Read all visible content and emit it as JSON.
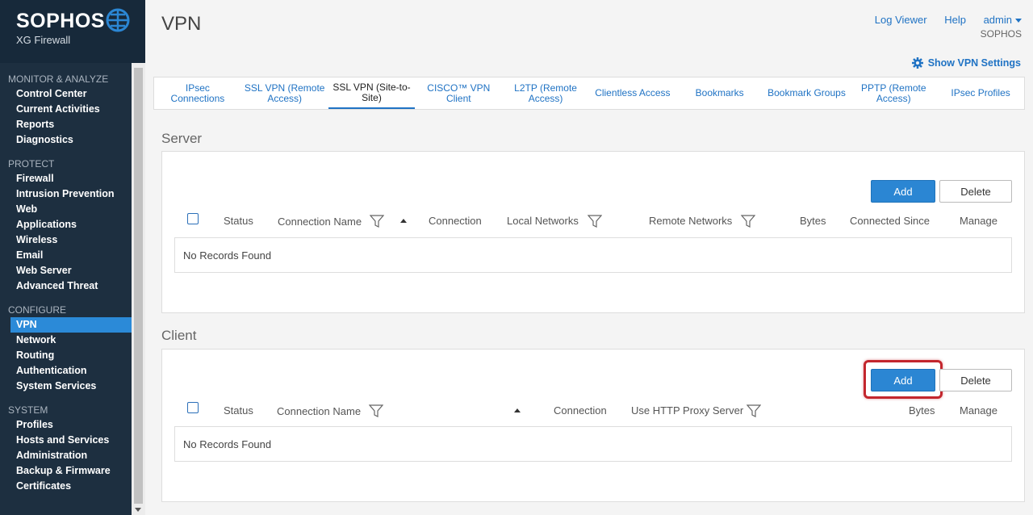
{
  "brand": {
    "name": "SOPHOS",
    "product": "XG Firewall"
  },
  "nav": {
    "sections": [
      {
        "title": "MONITOR & ANALYZE",
        "items": [
          "Control Center",
          "Current Activities",
          "Reports",
          "Diagnostics"
        ]
      },
      {
        "title": "PROTECT",
        "items": [
          "Firewall",
          "Intrusion Prevention",
          "Web",
          "Applications",
          "Wireless",
          "Email",
          "Web Server",
          "Advanced Threat"
        ]
      },
      {
        "title": "CONFIGURE",
        "items": [
          "VPN",
          "Network",
          "Routing",
          "Authentication",
          "System Services"
        ]
      },
      {
        "title": "SYSTEM",
        "items": [
          "Profiles",
          "Hosts and Services",
          "Administration",
          "Backup & Firmware",
          "Certificates"
        ]
      }
    ],
    "active": "VPN"
  },
  "page": {
    "title": "VPN"
  },
  "top": {
    "log_viewer": "Log Viewer",
    "help": "Help",
    "user": "admin",
    "org": "SOPHOS"
  },
  "settings_link": "Show VPN Settings",
  "tabs": [
    "IPsec Connections",
    "SSL VPN (Remote Access)",
    "SSL VPN (Site-to-Site)",
    "CISCO™ VPN Client",
    "L2TP (Remote Access)",
    "Clientless Access",
    "Bookmarks",
    "Bookmark Groups",
    "PPTP (Remote Access)",
    "IPsec Profiles"
  ],
  "active_tab": "SSL VPN (Site-to-Site)",
  "server": {
    "title": "Server",
    "add": "Add",
    "delete": "Delete",
    "columns": {
      "status": "Status",
      "connection_name": "Connection Name",
      "connection": "Connection",
      "local_networks": "Local Networks",
      "remote_networks": "Remote Networks",
      "bytes": "Bytes",
      "connected_since": "Connected Since",
      "manage": "Manage"
    },
    "empty": "No Records Found"
  },
  "client": {
    "title": "Client",
    "add": "Add",
    "delete": "Delete",
    "columns": {
      "status": "Status",
      "connection_name": "Connection Name",
      "connection": "Connection",
      "proxy": "Use HTTP Proxy Server",
      "bytes": "Bytes",
      "manage": "Manage"
    },
    "empty": "No Records Found"
  },
  "colors": {
    "sidebar": "#1d2f40",
    "accent": "#2b86d3",
    "highlight": "#c3262d"
  }
}
